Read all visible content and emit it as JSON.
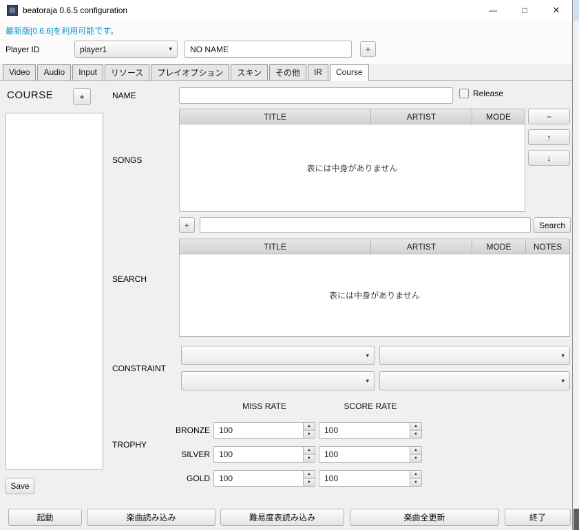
{
  "window": {
    "title": "beatoraja 0.6.5 configuration",
    "controls": {
      "minimize": "—",
      "maximize": "□",
      "close": "✕"
    }
  },
  "update_link": "最新版[0.6.6]を利用可能です。",
  "player": {
    "label": "Player ID",
    "selected": "player1",
    "name_value": "NO NAME",
    "add_button": "+"
  },
  "tabs": [
    {
      "label": "Video"
    },
    {
      "label": "Audio"
    },
    {
      "label": "Input"
    },
    {
      "label": "リソース"
    },
    {
      "label": "プレイオプション"
    },
    {
      "label": "スキン"
    },
    {
      "label": "その他"
    },
    {
      "label": "IR"
    },
    {
      "label": "Course",
      "active": true
    }
  ],
  "course": {
    "heading": "COURSE",
    "add_button": "+",
    "save_button": "Save",
    "name_label": "NAME",
    "release_label": "Release",
    "songs": {
      "label": "SONGS",
      "columns": [
        "TITLE",
        "ARTIST",
        "MODE"
      ],
      "empty_text": "表には中身がありません",
      "remove_button": "−",
      "up_button": "↑",
      "down_button": "↓"
    },
    "search": {
      "label": "SEARCH",
      "add_button": "+",
      "search_button": "Search",
      "columns": [
        "TITLE",
        "ARTIST",
        "MODE",
        "NOTES"
      ],
      "empty_text": "表には中身がありません"
    },
    "constraint": {
      "label": "CONSTRAINT"
    },
    "trophy": {
      "label": "TROPHY",
      "col_headers": [
        "MISS RATE",
        "SCORE RATE"
      ],
      "rows": [
        {
          "label": "BRONZE",
          "miss": "100",
          "score": "100"
        },
        {
          "label": "SILVER",
          "miss": "100",
          "score": "100"
        },
        {
          "label": "GOLD",
          "miss": "100",
          "score": "100"
        }
      ]
    }
  },
  "bottom_buttons": [
    "起動",
    "楽曲読み込み",
    "難易度表読み込み",
    "楽曲全更新",
    "終了"
  ]
}
